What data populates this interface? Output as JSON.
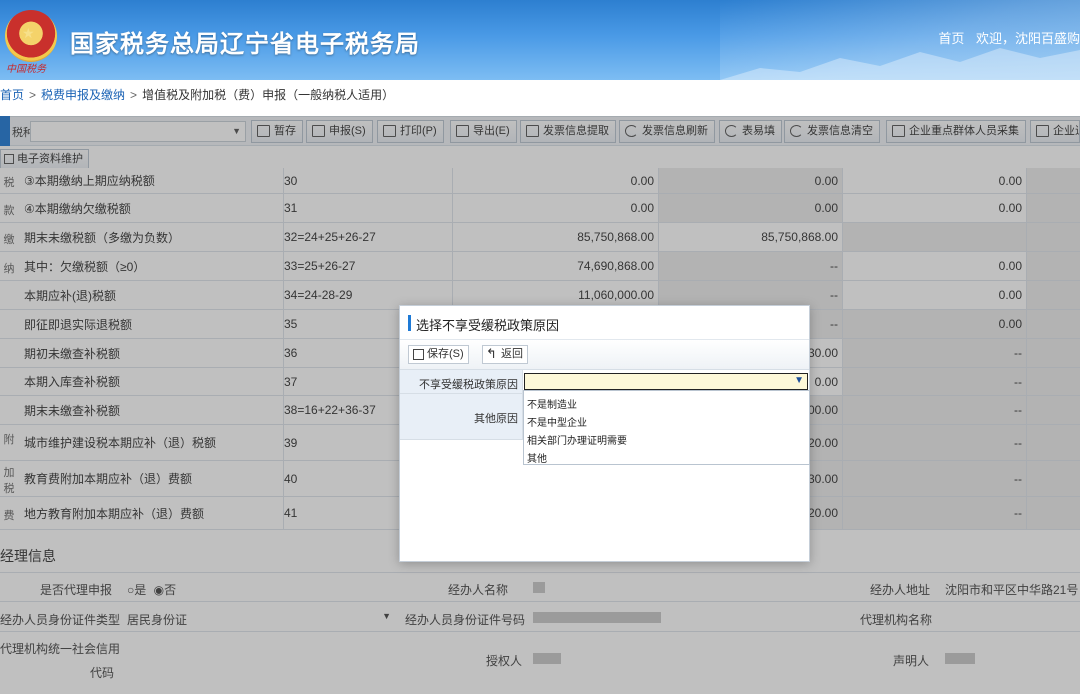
{
  "header": {
    "title": "国家税务总局辽宁省电子税务局",
    "signature": "中国税务",
    "links": [
      "首页",
      "欢迎，沈阳百盛购"
    ]
  },
  "breadcrumb": [
    "首页",
    "税费申报及缴纳",
    "增值税及附加税（费）申报（一般纳税人适用）"
  ],
  "toolbar": {
    "label": "税种:",
    "buttons": [
      "暂存",
      "申报(S)",
      "打印(P)",
      "导出(E)",
      "发票信息提取",
      "发票信息刷新",
      "表易填",
      "发票信息清空",
      "企业重点群体人员采集",
      "企业退"
    ],
    "sub_button": "电子资料维护"
  },
  "table": {
    "side_labels": [
      "税",
      "款",
      "缴",
      "纳",
      "附",
      "加",
      "税",
      "费"
    ],
    "rows": [
      {
        "name": "③本期缴纳上期应纳税额",
        "code": "30",
        "c1": "0.00",
        "c2": "0.00",
        "c3": "0.00"
      },
      {
        "name": "④本期缴纳欠缴税额",
        "code": "31",
        "c1": "0.00",
        "c2": "0.00",
        "c3": "0.00"
      },
      {
        "name": "期末未缴税额（多缴为负数）",
        "code": "32=24+25+26-27",
        "c1": "85,750,868.00",
        "c2": "85,750,868.00",
        "c3": ""
      },
      {
        "name": "其中：欠缴税额（≥0）",
        "code": "33=25+26-27",
        "c1": "74,690,868.00",
        "c2": "--",
        "c3": "0.00"
      },
      {
        "name": "本期应补(退)税额",
        "code": "34=24-28-29",
        "c1": "11,060,000.00",
        "c2": "--",
        "c3": "0.00"
      },
      {
        "name": "即征即退实际退税额",
        "code": "35",
        "c1": "",
        "c2": "--",
        "c3": "0.00"
      },
      {
        "name": "期初未缴查补税额",
        "code": "36",
        "c1": "",
        "c2": "30.00",
        "c3": "--"
      },
      {
        "name": "本期入库查补税额",
        "code": "37",
        "c1": "",
        "c2": "0.00",
        "c3": "--"
      },
      {
        "name": "期末未缴查补税额",
        "code": "38=16+22+36-37",
        "c1": "",
        "c2": "00.00",
        "c3": "--"
      },
      {
        "name": "城市维护建设税本期应补（退）税额",
        "code": "39",
        "c1": "",
        "c2": "20.00",
        "c3": "--"
      },
      {
        "name": "教育费附加本期应补（退）费额",
        "code": "40",
        "c1": "",
        "c2": "30.00",
        "c3": "--"
      },
      {
        "name": "地方教育附加本期应补（退）费额",
        "code": "41",
        "c1": "",
        "c2": "20.00",
        "c3": "--"
      }
    ]
  },
  "handler": {
    "section_title": "经理信息",
    "agent_label": "是否代理申报",
    "agent_yes": "是",
    "agent_no": "否",
    "handler_name_label": "经办人名称",
    "handler_addr_label": "经办人地址",
    "handler_addr_value": "沈阳市和平区中华路21号",
    "id_type_label": "经办人员身份证件类型",
    "id_type_value": "居民身份证",
    "id_no_label": "经办人员身份证件号码",
    "agency_name_label": "代理机构名称",
    "agency_code_label_1": "代理机构统一社会信用",
    "agency_code_label_2": "代码",
    "authorizer_label": "授权人",
    "declarer_label": "声明人"
  },
  "modal": {
    "title": "选择不享受缓税政策原因",
    "save_label": "保存(S)",
    "back_label": "返回",
    "reason_label": "不享受缓税政策原因",
    "other_label": "其他原因",
    "options": [
      "不是制造业",
      "不是中型企业",
      "相关部门办理证明需要",
      "其他"
    ]
  },
  "colors": {
    "accent": "#1e7ad6",
    "header_blue": "#2d7fd0",
    "combo_bg": "#fdf8d8"
  }
}
